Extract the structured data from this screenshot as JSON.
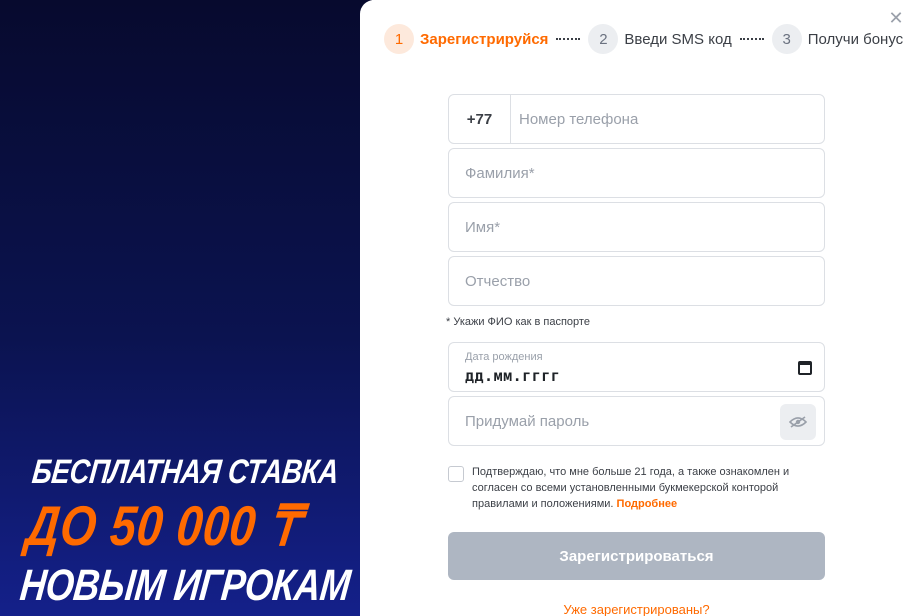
{
  "promo": {
    "line1": "БЕСПЛАТНАЯ СТАВКА",
    "line2": "ДО 50 000 ₸",
    "line3": "НОВЫМ ИГРОКАМ"
  },
  "modal": {
    "close_icon": "close-icon",
    "steps": [
      {
        "num": "1",
        "label": "Зарегистрируйся",
        "active": true
      },
      {
        "num": "2",
        "label": "Введи SMS код",
        "active": false
      },
      {
        "num": "3",
        "label": "Получи бонус",
        "active": false
      }
    ],
    "phone": {
      "prefix": "+77",
      "placeholder": "Номер телефона"
    },
    "surname": {
      "placeholder": "Фамилия*"
    },
    "name": {
      "placeholder": "Имя*"
    },
    "patronymic": {
      "placeholder": "Отчество"
    },
    "hint": "* Укажи ФИО как в паспорте",
    "birthdate": {
      "label": "Дата рождения",
      "value": "дд.мм.гггг"
    },
    "password": {
      "placeholder": "Придумай пароль"
    },
    "consent": {
      "text": "Подтверждаю, что мне больше 21 года, а также ознакомлен и согласен со всеми установленными букмекерской конторой правилами и положениями.",
      "link": "Подробнее"
    },
    "submit_label": "Зарегистрироваться",
    "login_link": "Уже зарегистрированы?"
  },
  "colors": {
    "accent": "#ff6a00",
    "button_disabled": "#aeb6c2",
    "promo_bg": "#0b1350"
  }
}
